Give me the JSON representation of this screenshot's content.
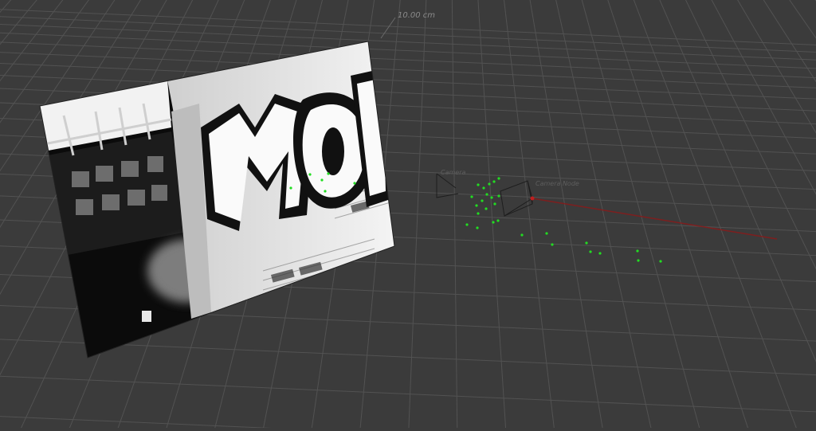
{
  "viewport": {
    "background": "#3b3b3b",
    "grid_color": "#555555",
    "scale_label": "10.00 cm"
  },
  "image_plane": {
    "description_icon": "graffiti-photo",
    "graffiti_text": "MOT"
  },
  "camera": {
    "label_left": "Camera",
    "label_right": "Camera Node",
    "trajectory_color": "#8a1a1a"
  },
  "point_cloud": {
    "color": "#22dd22"
  }
}
